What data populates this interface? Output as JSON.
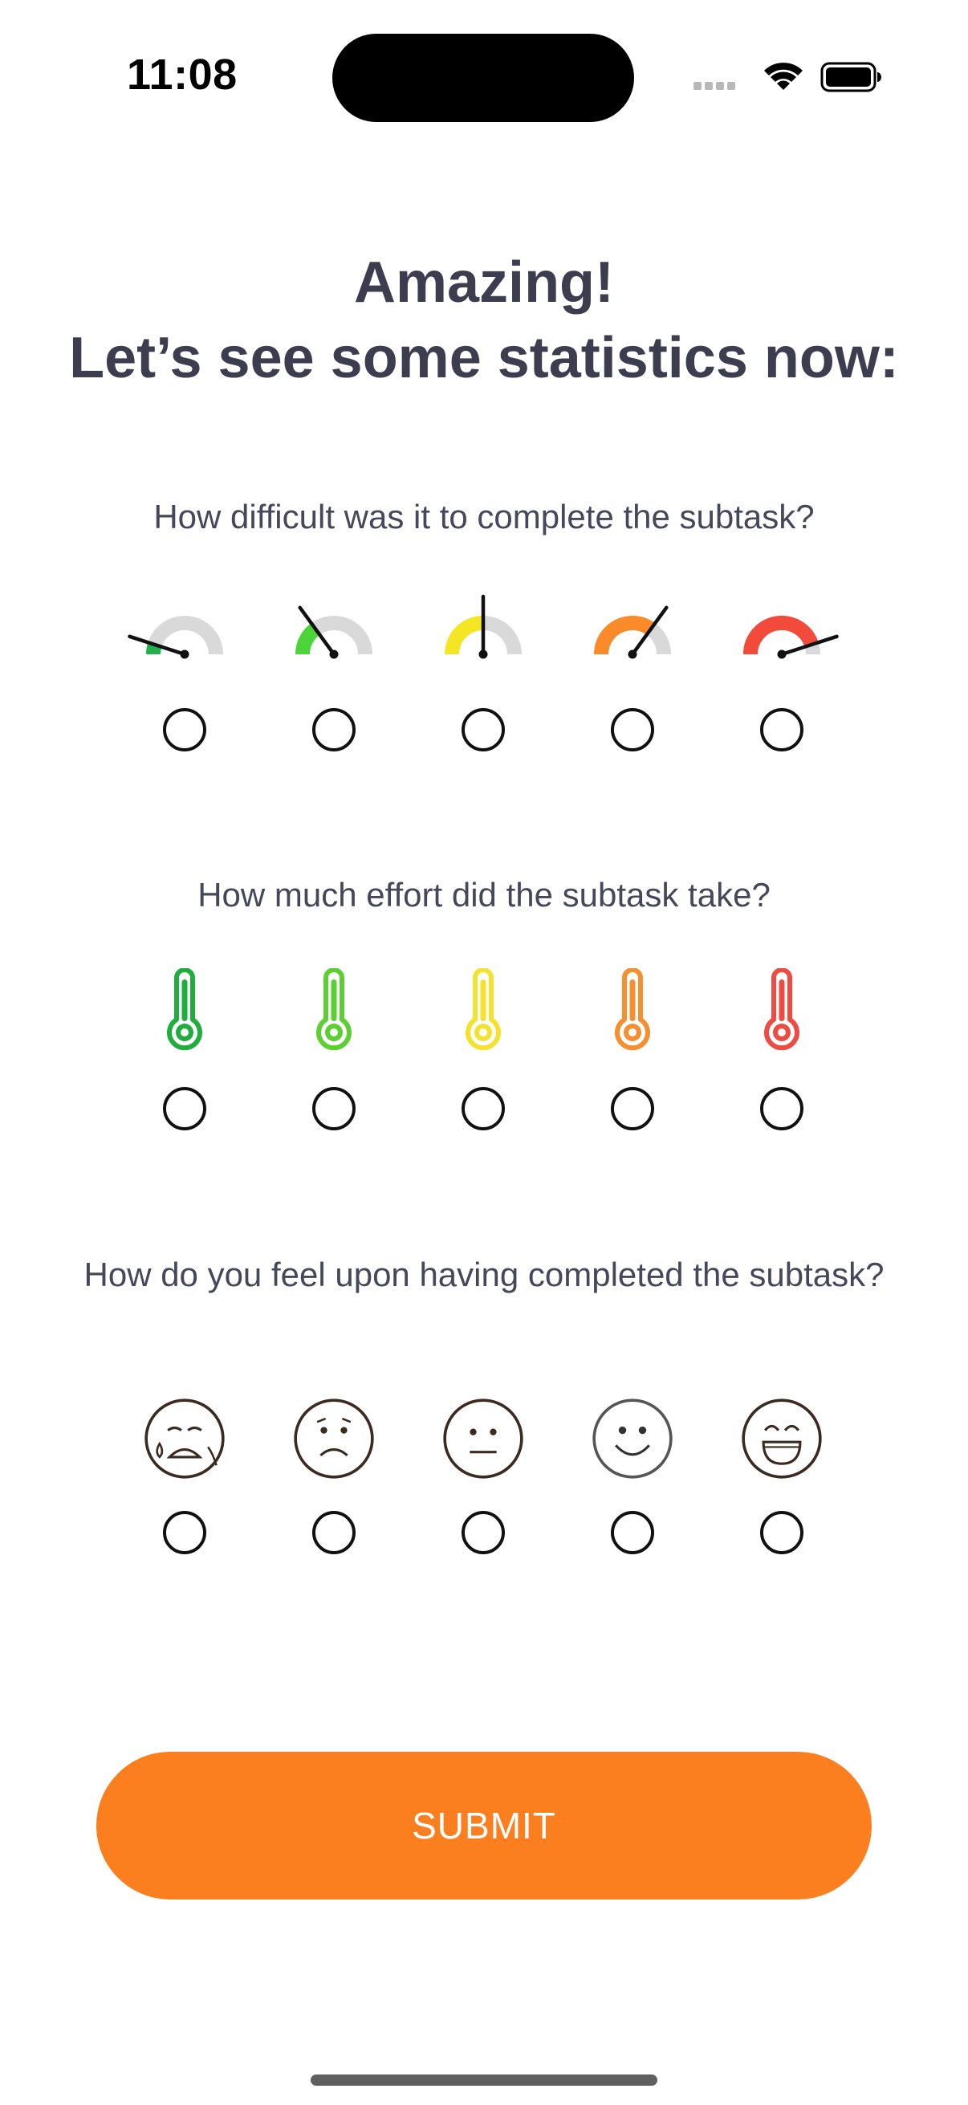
{
  "status_bar": {
    "time": "11:08",
    "icons": [
      "signal-icon",
      "wifi-icon",
      "battery-icon"
    ]
  },
  "header": {
    "line1": "Amazing!",
    "line2": "Let’s see some statistics now:"
  },
  "questions": [
    {
      "text": "How difficult was it to complete the subtask?",
      "icon_type": "gauge",
      "options": [
        {
          "icon": "gauge-very-easy-icon",
          "color": "#22b14c",
          "level": 0.1
        },
        {
          "icon": "gauge-easy-icon",
          "color": "#4cd43a",
          "level": 0.3
        },
        {
          "icon": "gauge-medium-icon",
          "color": "#f5e623",
          "level": 0.5
        },
        {
          "icon": "gauge-hard-icon",
          "color": "#fb8a2a",
          "level": 0.7
        },
        {
          "icon": "gauge-very-hard-icon",
          "color": "#f24b3b",
          "level": 0.9
        }
      ],
      "selected": null
    },
    {
      "text": "How much effort did the subtask take?",
      "icon_type": "thermometer",
      "options": [
        {
          "icon": "thermometer-very-low-icon",
          "color": "#1fae3e"
        },
        {
          "icon": "thermometer-low-icon",
          "color": "#5ccf32"
        },
        {
          "icon": "thermometer-medium-icon",
          "color": "#f3e230"
        },
        {
          "icon": "thermometer-high-icon",
          "color": "#f58f2f"
        },
        {
          "icon": "thermometer-very-high-icon",
          "color": "#ee4b42"
        }
      ],
      "selected": null
    },
    {
      "text": "How do you feel upon having completed the subtask?",
      "icon_type": "emoji",
      "options": [
        {
          "icon": "crying-face-icon",
          "mood": "crying"
        },
        {
          "icon": "sad-face-icon",
          "mood": "sad"
        },
        {
          "icon": "neutral-face-icon",
          "mood": "neutral"
        },
        {
          "icon": "smiling-face-icon",
          "mood": "smile"
        },
        {
          "icon": "laughing-face-icon",
          "mood": "laugh"
        }
      ],
      "selected": null
    }
  ],
  "submit": {
    "label": "SUBMIT",
    "color": "#fb7f1f"
  }
}
